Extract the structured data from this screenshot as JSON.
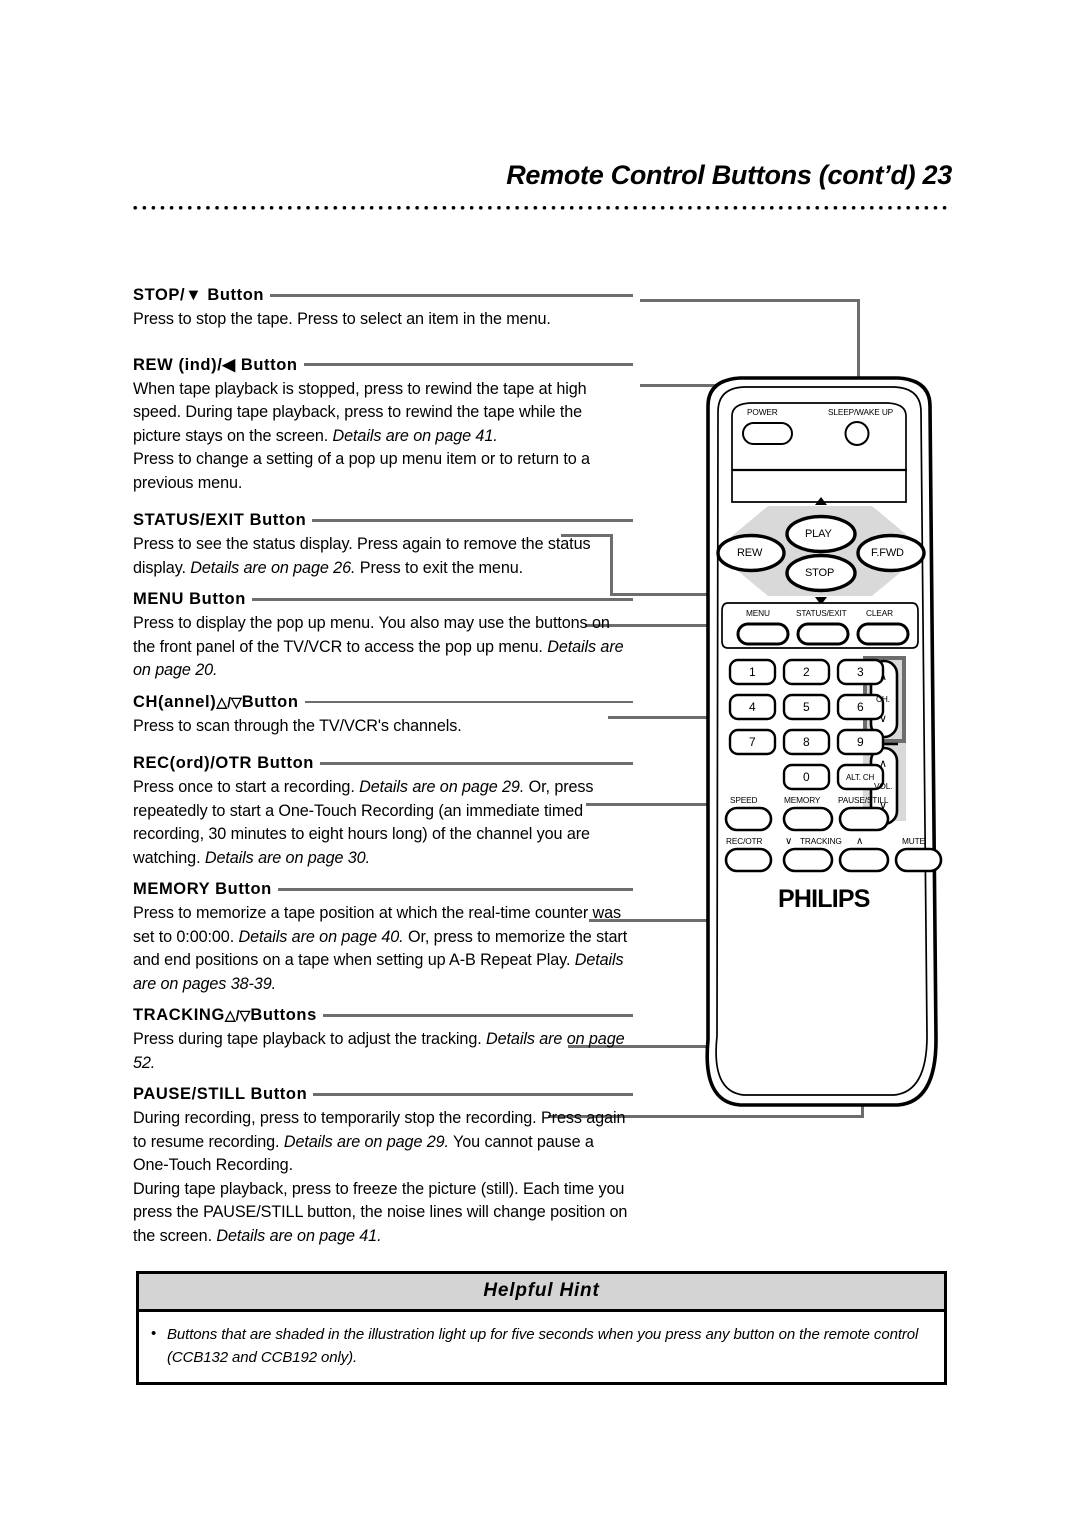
{
  "page": {
    "header_title": "Remote Control Buttons (cont’d)  23",
    "page_number": "23"
  },
  "sections": [
    {
      "id": "stop",
      "heading": "STOP/▼ Button",
      "body": "Press to stop the tape. Press to select an item in the menu."
    },
    {
      "id": "rew",
      "heading": "REW (ind)/◀ Button",
      "body": "When tape playback is stopped, press to rewind the tape at high speed.  During tape playback, press to rewind the tape while the picture stays on the screen. ",
      "body_italic": "Details are on page 41.",
      "body2": "Press to change a setting of a pop up menu item or to return to a previous menu."
    },
    {
      "id": "status-exit",
      "heading": "STATUS/EXIT Button",
      "body": "Press to see the status display. Press again to remove the status display. ",
      "body_italic": "Details are on page 26.",
      "body2": " Press to exit the menu."
    },
    {
      "id": "menu",
      "heading": "MENU Button",
      "body": "Press to display the pop up menu. You also may use the buttons on the front panel of the TV/VCR to access the pop up menu. ",
      "body_italic": "Details are on page 20."
    },
    {
      "id": "channel",
      "heading_pre": "CH(annel) ",
      "heading_tri": "△/▽",
      "heading_post": " Button",
      "body": "Press to scan through the TV/VCR's channels."
    },
    {
      "id": "rec-otr",
      "heading": "REC(ord)/OTR Button",
      "body": "Press once to start a recording. ",
      "body_italic": "Details are on page 29.",
      "body2": " Or, press repeatedly to start a One-Touch Recording (an immediate timed recording, 30 minutes to eight hours long) of the channel you are watching. ",
      "body_italic2": "Details are on page 30."
    },
    {
      "id": "memory",
      "heading": "MEMORY Button",
      "body": "Press to memorize a tape position at which the real-time counter was set to 0:00:00. ",
      "body_italic": "Details are on page 40.",
      "body2": " Or, press to memorize the start and end positions on a tape when setting up A-B Repeat Play. ",
      "body_italic2": "Details are on pages 38-39."
    },
    {
      "id": "tracking",
      "heading_pre": "TRACKING ",
      "heading_tri": "△/▽",
      "heading_post": " Buttons",
      "body": "Press during tape playback to adjust the tracking. ",
      "body_italic": "Details are on page 52."
    },
    {
      "id": "pause-still",
      "heading": "PAUSE/STILL Button",
      "body": "During recording, press to temporarily stop the recording. Press again to resume recording. ",
      "body_italic": "Details are on page 29.",
      "body2": " You cannot pause a One-Touch Recording.",
      "body3": "During tape playback, press to freeze the picture (still). Each time you press the PAUSE/STILL button, the noise lines will change position on the screen. ",
      "body_italic3": "Details are on page 41."
    }
  ],
  "hint": {
    "title": "Helpful Hint",
    "bullet": "•",
    "text": "Buttons that are shaded in the illustration light up for five seconds when you press any button on the remote control (CCB132 and CCB192 only)."
  },
  "remote": {
    "brand": "PHILIPS",
    "power_label": "POWER",
    "sleep_label": "SLEEP/WAKE UP",
    "transport": {
      "play": "PLAY",
      "stop": "STOP",
      "rew": "REW",
      "ffwd": "F.FWD"
    },
    "menu_row": [
      "MENU",
      "STATUS/EXIT",
      "CLEAR"
    ],
    "keypad": [
      "1",
      "2",
      "3",
      "4",
      "5",
      "6",
      "7",
      "8",
      "9",
      "0",
      "ALT. CH"
    ],
    "rockers": {
      "ch": "CH.",
      "vol": "VOL.",
      "up_glyph": "∧",
      "down_glyph": "∨"
    },
    "func_row1": [
      "SPEED",
      "MEMORY",
      "PAUSE/STILL"
    ],
    "func_row2": [
      "REC/OTR",
      "MUTE"
    ],
    "tracking_label": "TRACKING",
    "tracking_down": "∨",
    "tracking_up": "∧"
  },
  "colors": {
    "leader": "#6d6d6d",
    "shade": "#d9d9d9",
    "hint_header": "#d4d4d4",
    "ink": "#000000"
  }
}
